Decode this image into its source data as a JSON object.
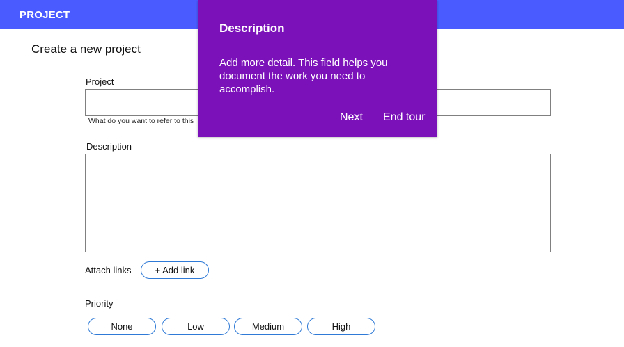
{
  "appbar": {
    "title": "PROJECT",
    "color": "#4a5cff"
  },
  "page_heading": "Create a new project",
  "form": {
    "project": {
      "label": "Project",
      "value": "",
      "helper": "What do you want to refer to this"
    },
    "description": {
      "label": "Description",
      "value": ""
    },
    "links": {
      "label": "Attach links",
      "add_button": "+ Add link"
    },
    "priority": {
      "label": "Priority",
      "options": [
        "None",
        "Low",
        "Medium",
        "High"
      ]
    }
  },
  "tour": {
    "title": "Description",
    "body": "Add more detail. This field helps you document the work you need to accomplish.",
    "next_label": "Next",
    "end_label": "End tour",
    "color": "#7b12b9"
  },
  "accent_color": "#2f7ad6"
}
